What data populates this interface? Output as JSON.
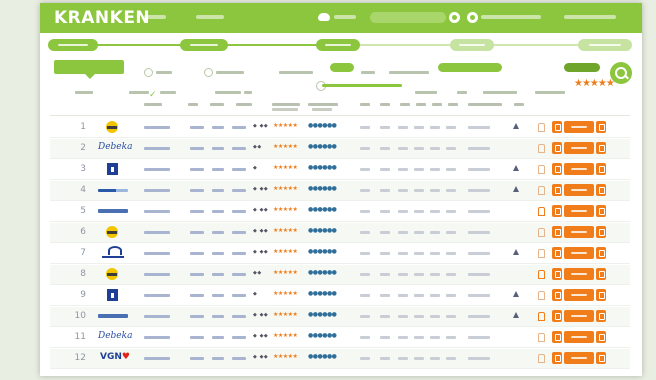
{
  "brand": {
    "name": "KRANKEN"
  },
  "colors": {
    "primary": "#8cc63f",
    "accent": "#f07d1a",
    "rank_text": "#8e96a5",
    "logo_blue": "#1f3f96"
  },
  "header": {
    "icons": [
      "cloud-icon",
      "user-icon",
      "help-icon"
    ]
  },
  "steps": {
    "count": 5,
    "active_count": 3
  },
  "filters": {
    "stars_icon": "★★★★★"
  },
  "table": {
    "rows": [
      {
        "rank": "1",
        "logo": "yellow-oval-logo",
        "rating": "◆ ◆◆",
        "stars": "★★★★★",
        "dots": "●●●●●●",
        "tri": true,
        "bell": "grey"
      },
      {
        "rank": "2",
        "logo": "text-logo",
        "logo_text": "Debeka",
        "rating": "◆◆",
        "stars": "★★★★★",
        "dots": "●●●●●●",
        "tri": false,
        "bell": "grey"
      },
      {
        "rank": "3",
        "logo": "blue-square-logo",
        "rating": "◆",
        "stars": "★★★★★",
        "dots": "●●●●●●",
        "tri": true,
        "bell": "grey"
      },
      {
        "rank": "4",
        "logo": "blue-line-logo",
        "rating": "◆ ◆◆",
        "stars": "★★★★★",
        "dots": "●●●●●●",
        "tri": true,
        "bell": "grey"
      },
      {
        "rank": "5",
        "logo": "small-blue-logo",
        "rating": "◆ ◆◆",
        "stars": "★★★★★",
        "dots": "●●●●●●",
        "tri": false,
        "bell": "orange"
      },
      {
        "rank": "6",
        "logo": "yellow-oval-logo",
        "rating": "◆ ◆◆",
        "stars": "★★★★★",
        "dots": "●●●●●●",
        "tri": false,
        "bell": "grey"
      },
      {
        "rank": "7",
        "logo": "swoosh-logo",
        "rating": "◆ ◆◆",
        "stars": "★★★★★",
        "dots": "●●●●●●",
        "tri": true,
        "bell": "grey"
      },
      {
        "rank": "8",
        "logo": "yellow-oval-logo",
        "rating": "◆◆",
        "stars": "★★★★★",
        "dots": "●●●●●●",
        "tri": false,
        "bell": "orange"
      },
      {
        "rank": "9",
        "logo": "blue-square-logo",
        "rating": "◆",
        "stars": "★★★★★",
        "dots": "●●●●●●",
        "tri": true,
        "bell": "grey"
      },
      {
        "rank": "10",
        "logo": "small-blue-logo",
        "rating": "◆ ◆◆",
        "stars": "★★★★★",
        "dots": "●●●●●●",
        "tri": true,
        "bell": "orange"
      },
      {
        "rank": "11",
        "logo": "text-logo",
        "logo_text": "Debeka",
        "rating": "◆ ◆◆",
        "stars": "★★★★★",
        "dots": "●●●●●●",
        "tri": false,
        "bell": "grey"
      },
      {
        "rank": "12",
        "logo": "vgn-logo",
        "logo_text": "VGN",
        "logo_heart": "♥",
        "rating": "◆ ◆◆",
        "stars": "★★★★★",
        "dots": "●●●●●●",
        "tri": false,
        "bell": "grey"
      }
    ]
  }
}
